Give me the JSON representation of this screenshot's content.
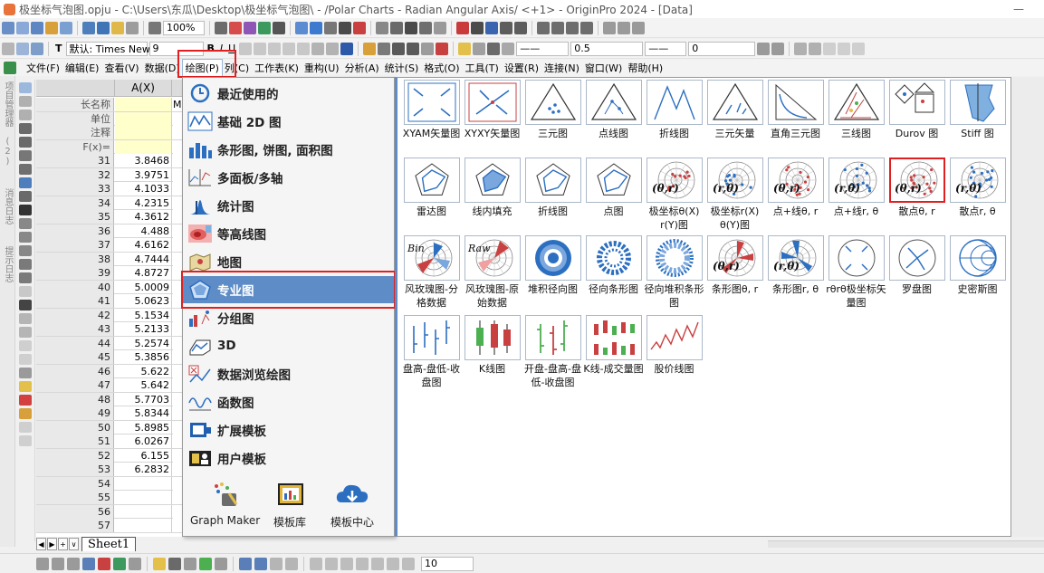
{
  "window": {
    "title": "极坐标气泡图.opju - C:\\Users\\东瓜\\Desktop\\极坐标气泡图\\ - /Polar Charts - Radian Angular Axis/ <+1> - OriginPro 2024 - [Data]",
    "minimize": "—"
  },
  "toolbar": {
    "zoom": "100%",
    "font_label": "默认: Times New R",
    "font_size": "9",
    "bold": "B",
    "italic": "I",
    "underline": "U",
    "line_width": "0.5",
    "line_offset": "0",
    "bottom_zoom": "10"
  },
  "menubar": {
    "items": [
      "文件(F)",
      "编辑(E)",
      "查看(V)",
      "数据(D)",
      "绘图(P)",
      "列(C)",
      "工作表(K)",
      "重构(U)",
      "分析(A)",
      "统计(S)",
      "格式(O)",
      "工具(T)",
      "设置(R)",
      "连接(N)",
      "窗口(W)",
      "帮助(H)"
    ],
    "active_index": 4
  },
  "left_dock": {
    "labels": [
      "项目管理器 (2)",
      "消息日志",
      "提示日志"
    ]
  },
  "worksheet": {
    "column_header": "A(X)",
    "meta_rows": [
      "长名称",
      "单位",
      "注释",
      "F(x)="
    ],
    "rows": [
      {
        "n": "31",
        "v": "3.8468"
      },
      {
        "n": "32",
        "v": "3.9751"
      },
      {
        "n": "33",
        "v": "4.1033"
      },
      {
        "n": "34",
        "v": "4.2315"
      },
      {
        "n": "35",
        "v": "4.3612"
      },
      {
        "n": "36",
        "v": "4.488"
      },
      {
        "n": "37",
        "v": "4.6162"
      },
      {
        "n": "38",
        "v": "4.7444"
      },
      {
        "n": "39",
        "v": "4.8727"
      },
      {
        "n": "40",
        "v": "5.0009"
      },
      {
        "n": "41",
        "v": "5.0623"
      },
      {
        "n": "42",
        "v": "5.1534"
      },
      {
        "n": "43",
        "v": "5.2133"
      },
      {
        "n": "44",
        "v": "5.2574"
      },
      {
        "n": "45",
        "v": "5.3856"
      },
      {
        "n": "46",
        "v": "5.622"
      },
      {
        "n": "47",
        "v": "5.642"
      },
      {
        "n": "48",
        "v": "5.7703"
      },
      {
        "n": "49",
        "v": "5.8344"
      },
      {
        "n": "50",
        "v": "5.8985"
      },
      {
        "n": "51",
        "v": "6.0267"
      },
      {
        "n": "52",
        "v": "6.155"
      },
      {
        "n": "53",
        "v": "6.2832"
      },
      {
        "n": "54",
        "v": ""
      },
      {
        "n": "55",
        "v": ""
      },
      {
        "n": "56",
        "v": ""
      },
      {
        "n": "57",
        "v": ""
      }
    ],
    "sheet_tab": "Sheet1",
    "partial_next_col": "M"
  },
  "plot_menu": {
    "items": [
      "最近使用的",
      "基础 2D 图",
      "条形图, 饼图, 面积图",
      "多面板/多轴",
      "统计图",
      "等高线图",
      "地图",
      "专业图",
      "分组图",
      "3D",
      "数据浏览绘图",
      "函数图",
      "扩展模板",
      "用户模板"
    ],
    "selected_index": 7,
    "bottom_buttons": [
      "Graph Maker",
      "模板库",
      "模板中心"
    ]
  },
  "gallery": {
    "rows": [
      [
        "XYAM矢量图",
        "XYXY矢量图",
        "三元图",
        "点线图",
        "折线图",
        "三元矢量",
        "直角三元图",
        "三线图",
        "Durov 图",
        "Stiff 图"
      ],
      [
        "雷达图",
        "线内填充",
        "折线图",
        "点图",
        "极坐标θ(X) r(Y)图",
        "极坐标r(X) θ(Y)图",
        "点+线θ, r",
        "点+线r, θ",
        "散点θ, r",
        "散点r, θ"
      ],
      [
        "风玫瑰图-分格数据",
        "风玫瑰图-原始数据",
        "堆积径向图",
        "径向条形图",
        "径向堆积条形图",
        "条形图θ, r",
        "条形图r, θ",
        "rθrθ极坐标矢量图",
        "罗盘图",
        "史密斯图"
      ],
      [
        "盘高-盘低-收盘图",
        "K线图",
        "开盘-盘高-盘低-收盘图",
        "K线-成交量图",
        "股价线图"
      ]
    ],
    "highlight": "散点θ, r",
    "overlays": {
      "polar_theta_r": "(θ,r)",
      "polar_r_theta": "(r,θ)",
      "bin": "Bin",
      "raw": "Raw"
    }
  },
  "colors": {
    "accent": "#5e8cc6",
    "highlight": "#e02020",
    "meta_yellow": "#ffffcc"
  }
}
